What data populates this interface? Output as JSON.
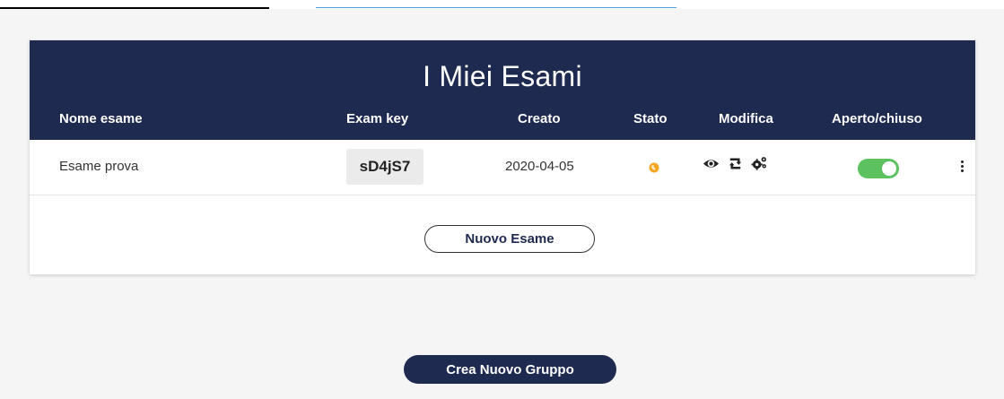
{
  "card": {
    "title": "I Miei Esami",
    "columns": {
      "name": "Nome esame",
      "key": "Exam key",
      "created": "Creato",
      "status": "Stato",
      "edit": "Modifica",
      "open_closed": "Aperto/chiuso"
    },
    "rows": [
      {
        "name": "Esame prova",
        "key": "sD4jS7",
        "created": "2020-04-05",
        "status_icon": "globe-icon",
        "status_color": "#f5a623",
        "actions": [
          "eye-icon",
          "retweet-icon",
          "gears-icon"
        ],
        "open": true
      }
    ],
    "new_exam_label": "Nuovo Esame"
  },
  "new_group_label": "Crea Nuovo Gruppo",
  "colors": {
    "header_bg": "#1e2a4f",
    "toggle_on": "#5cc15f",
    "status_globe": "#f5a623"
  }
}
